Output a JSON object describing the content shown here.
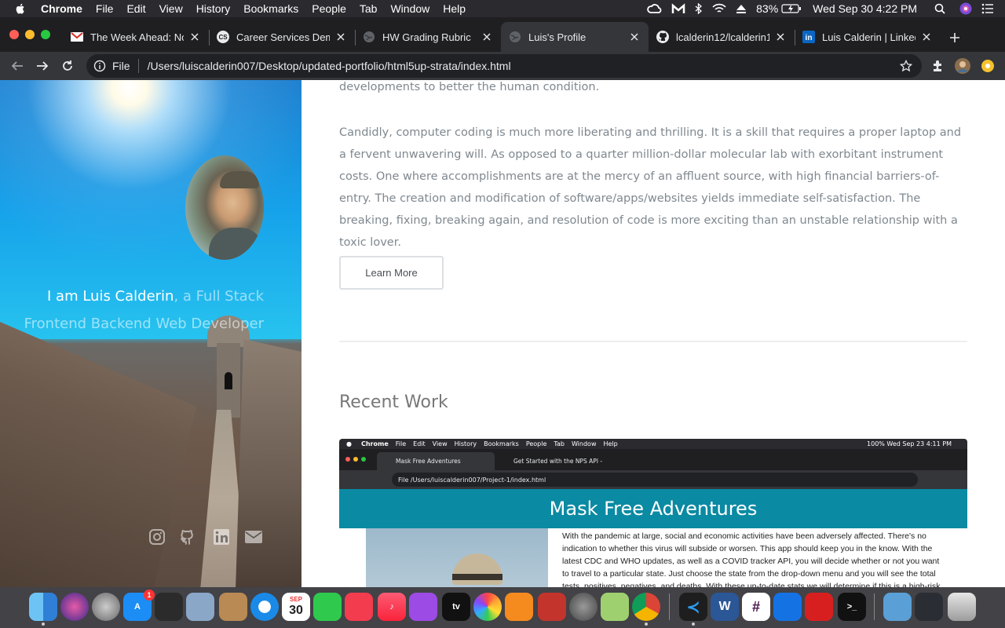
{
  "menubar": {
    "items": [
      "Chrome",
      "File",
      "Edit",
      "View",
      "History",
      "Bookmarks",
      "People",
      "Tab",
      "Window",
      "Help"
    ],
    "battery": "83%",
    "datetime": "Wed Sep 30  4:22 PM"
  },
  "tabs": [
    {
      "title": "The Week Ahead: No",
      "icon": "gmail-icon"
    },
    {
      "title": "Career Services Dem",
      "icon": "cs-icon"
    },
    {
      "title": "HW Grading Rubric",
      "icon": "globe-icon"
    },
    {
      "title": "Luis's Profile",
      "icon": "globe-icon",
      "active": true
    },
    {
      "title": "lcalderin12/lcalderin1",
      "icon": "github-icon"
    },
    {
      "title": "Luis Calderin | Linked",
      "icon": "linkedin-icon"
    }
  ],
  "toolbar": {
    "scheme": "File",
    "url": "/Users/luiscalderin007/Desktop/updated-portfolio/html5up-strata/index.html"
  },
  "sidebar": {
    "intro_strong": "I am Luis Calderin",
    "intro_rest": ", a Full Stack Frontend Backend Web Developer",
    "social": [
      "instagram-icon",
      "github-icon",
      "linkedin-icon",
      "email-icon"
    ]
  },
  "main": {
    "para_top": "developments to better the human condition.",
    "para_main": "Candidly, computer coding is much more liberating and thrilling. It is a skill that requires a proper laptop and a fervent unwavering will. As opposed to a quarter million-dollar molecular lab with exorbitant instrument costs. One where accomplishments are at the mercy of an affluent source, with high financial barriers-of-entry. The creation and modification of software/apps/websites yields immediate self-satisfaction. The breaking, fixing, breaking again, and resolution of code is more exciting than an unstable relationship with a toxic lover.",
    "learn_more": "Learn More",
    "recent_work": "Recent Work",
    "project": {
      "menu_items": [
        "Chrome",
        "File",
        "Edit",
        "View",
        "History",
        "Bookmarks",
        "People",
        "Tab",
        "Window",
        "Help"
      ],
      "menu_status": "100%   Wed Sep 23  4:11 PM",
      "tab1": "Mask Free Adventures",
      "tab2": "Get Started with the NPS API -",
      "url": "File   /Users/luiscalderin007/Project-1/index.html",
      "title": "Mask Free Adventures",
      "description": "With the pandemic at large, social and economic activities have been adversely affected. There's no indication to whether this virus will subside or worsen. This app should keep you in the know. With the latest CDC and WHO updates, as well as a COVID tracker API, you will decide whether or not you want to travel to a particular state. Just choose the state from the drop-down menu and you will see the total tests, positives, negatives, and deaths. With these up-to-date stats we will determine if this is a high-risk area or"
    }
  },
  "dock": {
    "calendar_month": "SEP",
    "calendar_day": "30",
    "appstore_badge": "1"
  }
}
